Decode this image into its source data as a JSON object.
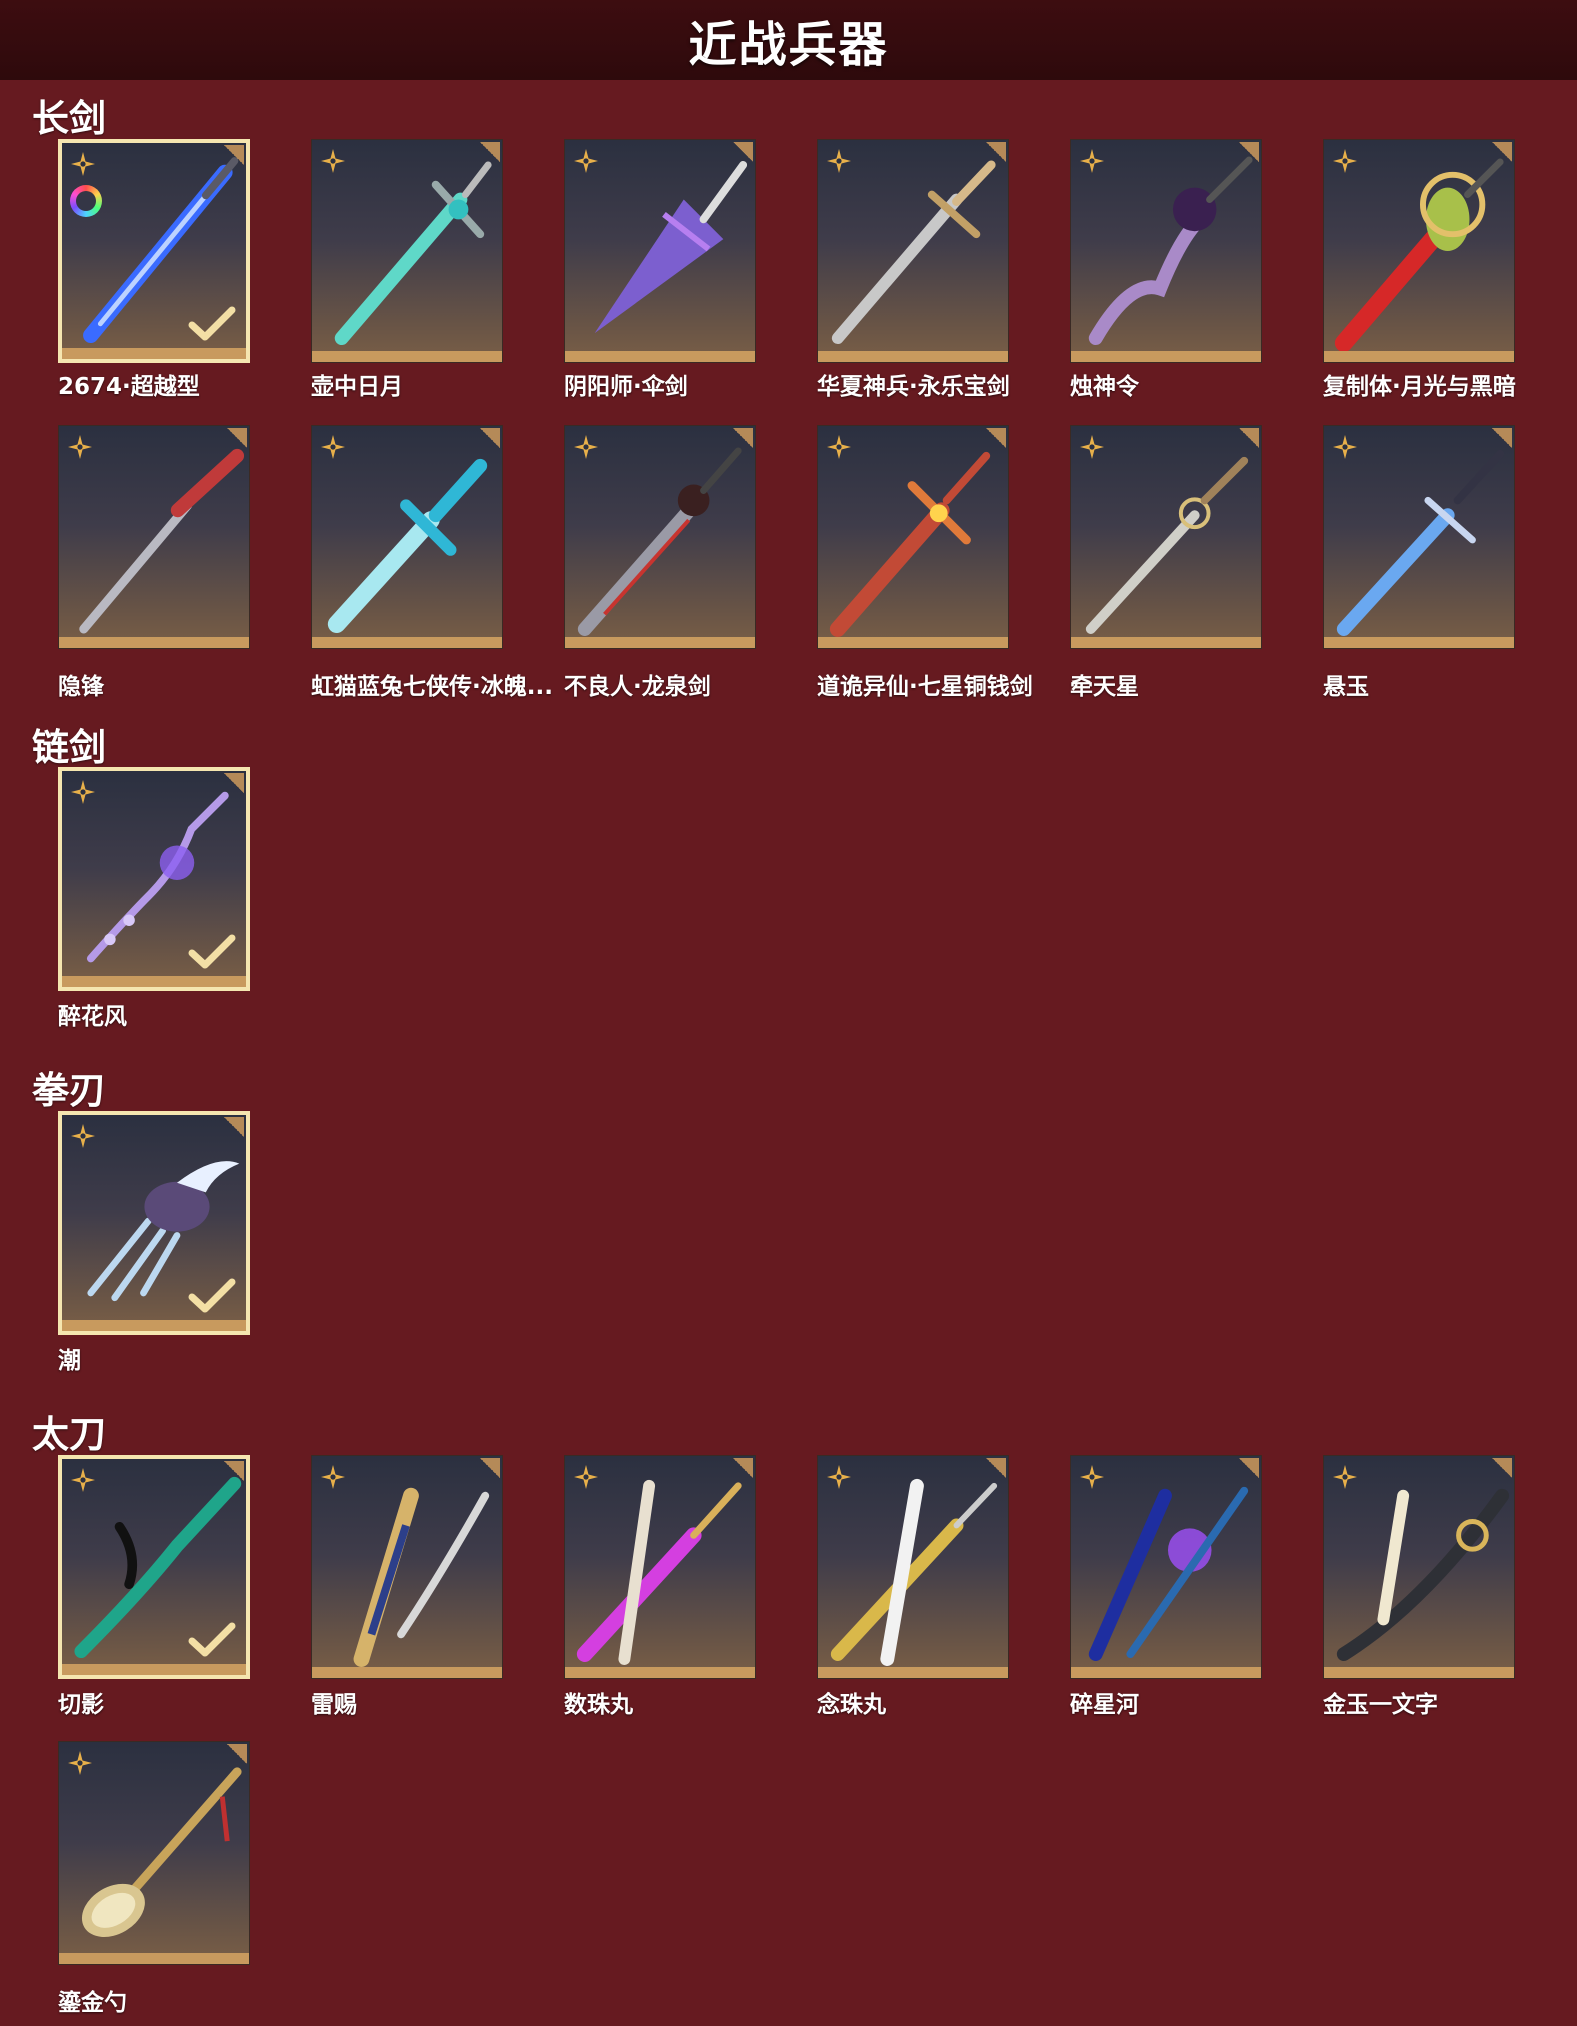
{
  "header": {
    "title": "近战兵器"
  },
  "sections": [
    {
      "title": "长剑",
      "items": [
        {
          "name": "2674·超越型"
        },
        {
          "name": "壶中日月"
        },
        {
          "name": "阴阳师·伞剑"
        },
        {
          "name": "华夏神兵·永乐宝剑"
        },
        {
          "name": "烛神令"
        },
        {
          "name": "复制体·月光与黑暗"
        },
        {
          "name": "隐锋"
        },
        {
          "name": "虹猫蓝兔七侠传·冰魄..."
        },
        {
          "name": "不良人·龙泉剑"
        },
        {
          "name": "道诡异仙·七星铜钱剑"
        },
        {
          "name": "牵天星"
        },
        {
          "name": "悬玉"
        }
      ]
    },
    {
      "title": "链剑",
      "items": [
        {
          "name": "醉花风"
        }
      ]
    },
    {
      "title": "拳刃",
      "items": [
        {
          "name": "潮"
        }
      ]
    },
    {
      "title": "太刀",
      "items": [
        {
          "name": "切影"
        },
        {
          "name": "雷赐"
        },
        {
          "name": "数珠丸"
        },
        {
          "name": "念珠丸"
        },
        {
          "name": "碎星河"
        },
        {
          "name": "金玉一文字"
        },
        {
          "name": "鎏金勺"
        }
      ]
    }
  ],
  "colors": {
    "background": "#661a20",
    "header": "#2e0a0c",
    "selected_border": "#f5e6b0",
    "card_strip": "#c89a5e",
    "star_icon": "#e8b04a"
  },
  "icons": {
    "rarity": "four-point-star-icon",
    "equipped": "checkmark-icon",
    "dye": "color-ring-icon"
  }
}
